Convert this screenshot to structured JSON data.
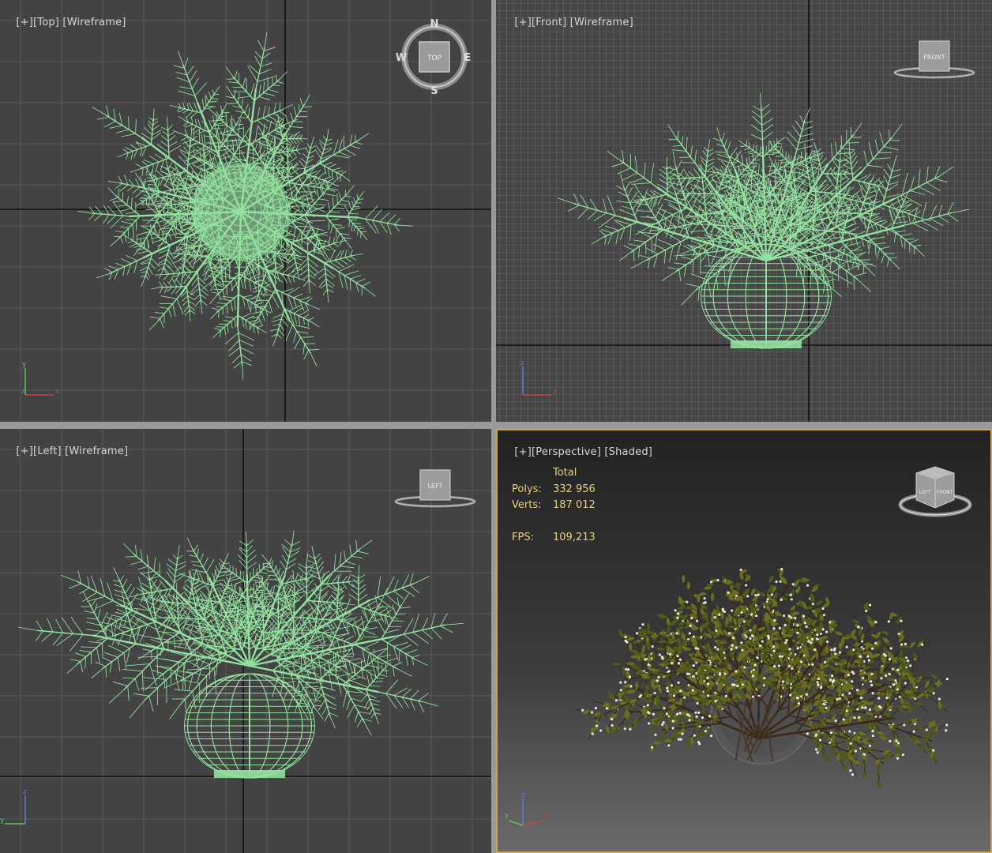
{
  "viewports": {
    "top": {
      "plus": "[+]",
      "view": "[Top]",
      "mode": "[Wireframe]",
      "cube_face": "TOP",
      "compass": {
        "n": "N",
        "s": "S",
        "e": "E",
        "w": "W"
      }
    },
    "front": {
      "plus": "[+]",
      "view": "[Front]",
      "mode": "[Wireframe]",
      "cube_face": "FRONT"
    },
    "left": {
      "plus": "[+]",
      "view": "[Left]",
      "mode": "[Wireframe]",
      "cube_face": "LEFT"
    },
    "perspective": {
      "plus": "[+]",
      "view": "[Perspective]",
      "mode": "[Shaded]",
      "cube_faces": {
        "left": "LEFT",
        "front": "FRONT"
      },
      "stats": {
        "header": "Total",
        "polys_label": "Polys:",
        "polys_value": "332 956",
        "verts_label": "Verts:",
        "verts_value": "187 012",
        "fps_label": "FPS:",
        "fps_value": "109,213"
      }
    }
  },
  "axes": {
    "x": "x",
    "y": "y",
    "z": "z"
  },
  "colors": {
    "wire": "#93e19f",
    "viewport_bg": "#434343",
    "grid": "#555555",
    "active_border": "#c8a84a",
    "stats_text": "#e7d27a"
  }
}
